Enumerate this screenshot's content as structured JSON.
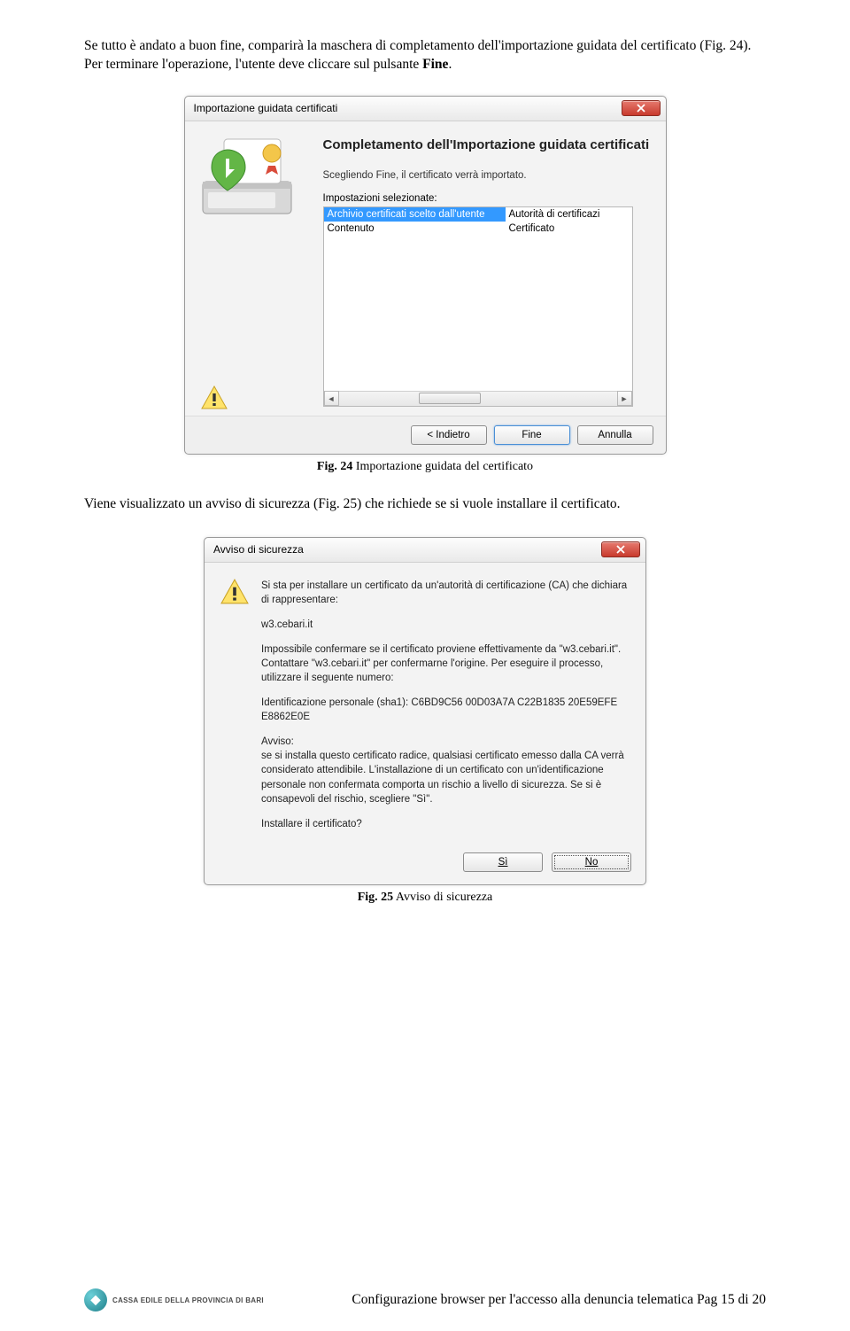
{
  "para1_a": "Se tutto è andato a buon fine, comparirà la maschera di completamento dell'importazione guidata del certificato (Fig. 24). Per terminare l'operazione, l'utente deve cliccare sul pulsante ",
  "para1_b": "Fine",
  "para1_c": ".",
  "dialog1": {
    "title": "Importazione guidata certificati",
    "heading": "Completamento dell'Importazione guidata certificati",
    "subtext": "Scegliendo Fine, il certificato verrà importato.",
    "settings_label": "Impostazioni selezionate:",
    "rows": [
      {
        "c1": "Archivio certificati scelto dall'utente",
        "c2": "Autorità di certificazi"
      },
      {
        "c1": "Contenuto",
        "c2": "Certificato"
      }
    ],
    "btn_back": "< Indietro",
    "btn_finish": "Fine",
    "btn_cancel": "Annulla"
  },
  "caption1_a": "Fig. 24",
  "caption1_b": " Importazione guidata del certificato",
  "para2": "Viene visualizzato un avviso di sicurezza (Fig. 25) che richiede se si vuole installare il certificato.",
  "dialog2": {
    "title": "Avviso di sicurezza",
    "p1": "Si sta per installare un certificato da un'autorità di certificazione (CA) che dichiara di rappresentare:",
    "p2": "w3.cebari.it",
    "p3": "Impossibile confermare se il certificato proviene effettivamente da \"w3.cebari.it\". Contattare \"w3.cebari.it\" per confermarne l'origine. Per eseguire il processo, utilizzare il seguente numero:",
    "p4": "Identificazione personale (sha1): C6BD9C56 00D03A7A C22B1835 20E59EFE E8862E0E",
    "p5a": "Avviso:",
    "p5b": "se si installa questo certificato radice, qualsiasi certificato emesso dalla CA verrà considerato attendibile. L'installazione di un certificato con un'identificazione personale non confermata comporta un rischio a livello di sicurezza. Se si è consapevoli del rischio, scegliere \"Sì\".",
    "p6": "Installare il certificato?",
    "btn_yes": "Sì",
    "btn_no": "No"
  },
  "caption2_a": "Fig. 25",
  "caption2_b": " Avviso di sicurezza",
  "footer": {
    "logo_text": "CASSA EDILE DELLA PROVINCIA DI BARI",
    "page_text": "Configurazione browser per l'accesso alla denuncia telematica Pag 15 di 20"
  }
}
